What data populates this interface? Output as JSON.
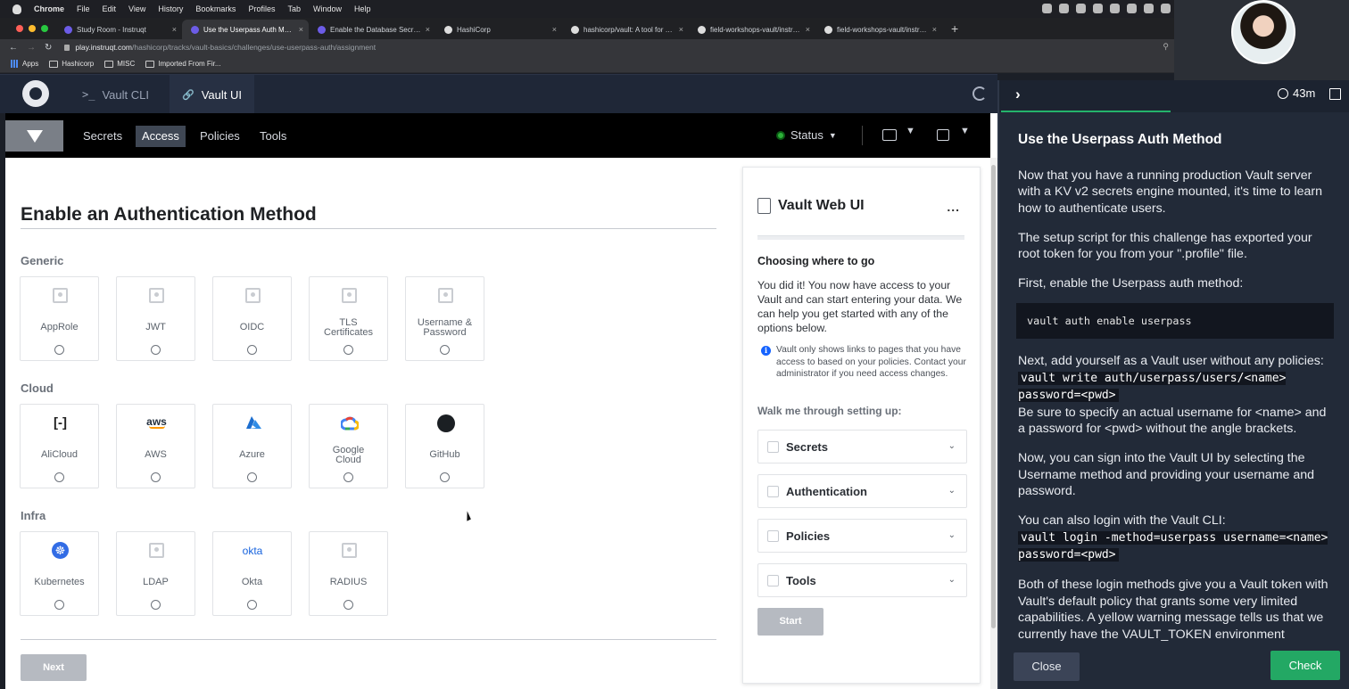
{
  "os_menubar": {
    "items": [
      "Chrome",
      "File",
      "Edit",
      "View",
      "History",
      "Bookmarks",
      "Profiles",
      "Tab",
      "Window",
      "Help"
    ]
  },
  "browser": {
    "tabs": [
      {
        "title": "Study Room - Instruqt",
        "active": false
      },
      {
        "title": "Use the Userpass Auth Method",
        "active": true
      },
      {
        "title": "Enable the Database Secrets E",
        "active": false
      },
      {
        "title": "HashiCorp",
        "active": false
      },
      {
        "title": "hashicorp/vault: A tool for secr",
        "active": false
      },
      {
        "title": "field-workshops-vault/instruqt",
        "active": false
      },
      {
        "title": "field-workshops-vault/instruqt",
        "active": false
      }
    ],
    "new_tab": "+",
    "close_glyph": "×",
    "url_host": "play.instruqt.com",
    "url_path": "/hashicorp/tracks/vault-basics/challenges/use-userpass-auth/assignment",
    "bookmarks": [
      "Apps",
      "Hashicorp",
      "MISC",
      "Imported From Fir..."
    ]
  },
  "instruqt": {
    "tabs": [
      {
        "glyph": ">_",
        "label": "Vault CLI"
      },
      {
        "glyph": "🔗",
        "label": "Vault UI"
      }
    ]
  },
  "vault": {
    "nav": [
      "Secrets",
      "Access",
      "Policies",
      "Tools"
    ],
    "status_label": "Status",
    "page_title": "Enable an Authentication Method",
    "sections": [
      {
        "title": "Generic",
        "methods": [
          "AppRole",
          "JWT",
          "OIDC",
          "TLS Certificates",
          "Username & Password"
        ]
      },
      {
        "title": "Cloud",
        "methods": [
          "AliCloud",
          "AWS",
          "Azure",
          "Google Cloud",
          "GitHub"
        ]
      },
      {
        "title": "Infra",
        "methods": [
          "Kubernetes",
          "LDAP",
          "Okta",
          "RADIUS"
        ]
      }
    ],
    "next_label": "Next",
    "wizard": {
      "title": "Vault Web UI",
      "more": "...",
      "heading": "Choosing where to go",
      "body": "You did it! You now have access to your Vault and can start entering your data. We can help you get started with any of the options below.",
      "note_icon": "i",
      "note": "Vault only shows links to pages that you have access to based on your policies. Contact your administrator if you need access changes.",
      "walk_label": "Walk me through setting up:",
      "items": [
        "Secrets",
        "Authentication",
        "Policies",
        "Tools"
      ],
      "start_label": "Start"
    }
  },
  "panel": {
    "timer": "43m",
    "title": "Use the Userpass Auth Method",
    "p1": "Now that you have a running production Vault server with a KV v2 secrets engine mounted, it's time to learn how to authenticate users.",
    "p2": "The setup script for this challenge has exported your root token for you from your \".profile\" file.",
    "p3": "First, enable the Userpass auth method:",
    "code1": "vault auth enable userpass",
    "p4": "Next, add yourself as a Vault user without any policies:",
    "code2": "vault write auth/userpass/users/<name> password=<pwd>",
    "p4b": "Be sure to specify an actual username for <name> and a password for <pwd> without the angle brackets.",
    "p5": "Now, you can sign into the Vault UI by selecting the Username method and providing your username and password.",
    "p6": "You can also login with the Vault CLI:",
    "code3": "vault login -method=userpass username=<name> password=<pwd>",
    "p7": "Both of these login methods give you a Vault token with Vault's default policy that grants some very limited capabilities. A yellow warning message tells us that we currently have the VAULT_TOKEN environment variable",
    "close_label": "Close",
    "check_label": "Check"
  },
  "colors": {
    "vault_nav": "#000000",
    "instruqt_bar": "#1f2737",
    "panel_bg": "#222a38",
    "check_green": "#23a864",
    "status_green": "#2eb039"
  }
}
